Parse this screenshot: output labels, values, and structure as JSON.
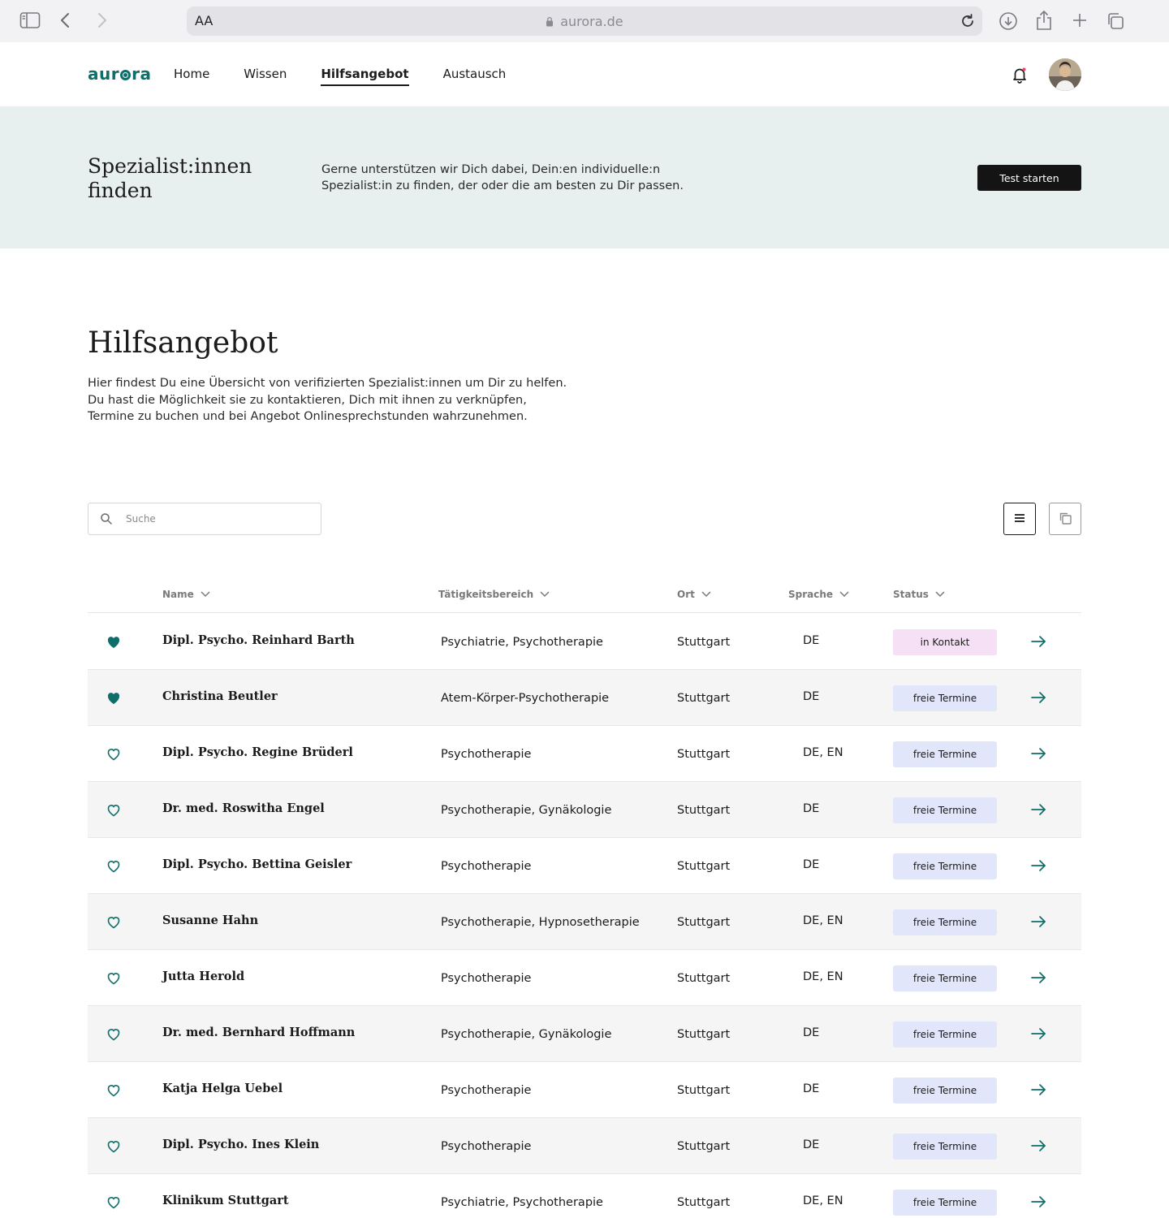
{
  "browser": {
    "aa_label": "AA",
    "url": "aurora.de"
  },
  "nav": {
    "logo": "aurora",
    "links": [
      {
        "label": "Home",
        "active": false
      },
      {
        "label": "Wissen",
        "active": false
      },
      {
        "label": "Hilfsangebot",
        "active": true
      },
      {
        "label": "Austausch",
        "active": false
      }
    ]
  },
  "hero": {
    "title": "Spezialist:innen finden",
    "text": "Gerne unterstützen wir Dich dabei,  Dein:en individuelle:n Spezialist:in zu finden, der oder die am besten zu Dir passen.",
    "button": "Test starten"
  },
  "main": {
    "title": "Hilfsangebot",
    "intro": "Hier findest Du eine Übersicht von verifizierten Spezialist:innen um Dir zu helfen. Du hast die Möglichkeit sie zu kontaktieren, Dich mit ihnen zu verknüpfen, Termine zu buchen und bei Angebot Onlinesprechstunden wahrzunehmen."
  },
  "search": {
    "placeholder": "Suche",
    "value": ""
  },
  "table": {
    "headers": {
      "name": "Name",
      "area": "Tätigkeitsbereich",
      "ort": "Ort",
      "lang": "Sprache",
      "status": "Status"
    },
    "rows": [
      {
        "favorite": true,
        "name": "Dipl. Psycho. Reinhard Barth",
        "area": "Psychiatrie, Psychotherapie",
        "ort": "Stuttgart",
        "lang": "DE",
        "status": "in Kontakt"
      },
      {
        "favorite": true,
        "name": "Christina Beutler",
        "area": "Atem-Körper-Psychotherapie",
        "ort": "Stuttgart",
        "lang": "DE",
        "status": "freie Termine"
      },
      {
        "favorite": false,
        "name": "Dipl. Psycho. Regine Brüderl",
        "area": "Psychotherapie",
        "ort": "Stuttgart",
        "lang": "DE, EN",
        "status": "freie Termine"
      },
      {
        "favorite": false,
        "name": "Dr. med. Roswitha Engel",
        "area": "Psychotherapie, Gynäkologie",
        "ort": "Stuttgart",
        "lang": "DE",
        "status": "freie Termine"
      },
      {
        "favorite": false,
        "name": "Dipl. Psycho. Bettina Geisler",
        "area": "Psychotherapie",
        "ort": "Stuttgart",
        "lang": "DE",
        "status": "freie Termine"
      },
      {
        "favorite": false,
        "name": "Susanne Hahn",
        "area": "Psychotherapie, Hypnosetherapie",
        "ort": "Stuttgart",
        "lang": "DE, EN",
        "status": "freie Termine"
      },
      {
        "favorite": false,
        "name": "Jutta Herold",
        "area": "Psychotherapie",
        "ort": "Stuttgart",
        "lang": "DE, EN",
        "status": "freie Termine"
      },
      {
        "favorite": false,
        "name": "Dr. med. Bernhard Hoffmann",
        "area": "Psychotherapie, Gynäkologie",
        "ort": "Stuttgart",
        "lang": "DE",
        "status": "freie Termine"
      },
      {
        "favorite": false,
        "name": "Katja Helga Uebel",
        "area": "Psychotherapie",
        "ort": "Stuttgart",
        "lang": "DE",
        "status": "freie Termine"
      },
      {
        "favorite": false,
        "name": "Dipl. Psycho. Ines Klein",
        "area": "Psychotherapie",
        "ort": "Stuttgart",
        "lang": "DE",
        "status": "freie Termine"
      },
      {
        "favorite": false,
        "name": "Klinikum Stuttgart",
        "area": "Psychiatrie, Psychotherapie",
        "ort": "Stuttgart",
        "lang": "DE, EN",
        "status": "freie Termine"
      }
    ]
  },
  "colors": {
    "brand": "#0e6e6a",
    "hero_bg": "#e8f0ef",
    "status_contact": "#f6e0f6",
    "status_free": "#e1e6fb",
    "button_dark": "#141414"
  },
  "icons": {
    "sidebar": "sidebar-toggle-icon",
    "back": "chevron-left-icon",
    "forward": "chevron-right-icon",
    "lock": "lock-icon",
    "reload": "reload-icon",
    "download": "download-icon",
    "share": "share-icon",
    "new_tab": "plus-icon",
    "tabs": "tabs-icon",
    "notifications": "bell-icon",
    "search": "search-icon",
    "list_view": "list-view-icon",
    "grid_view": "grid-view-icon",
    "favorite": "heart-icon",
    "open": "arrow-right-icon"
  }
}
